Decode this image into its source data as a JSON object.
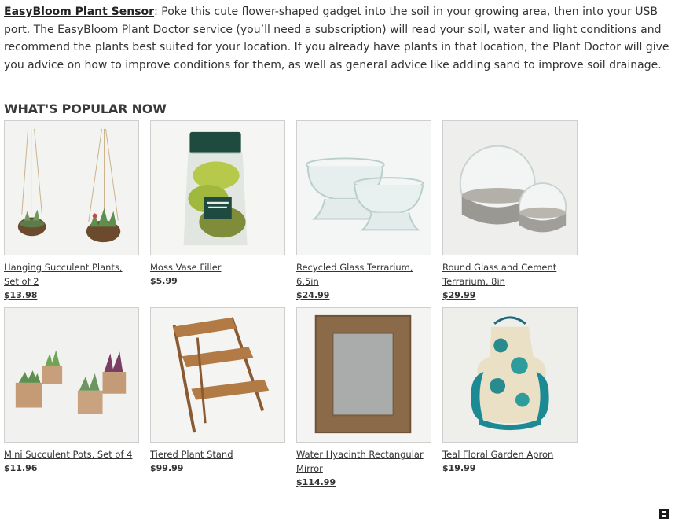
{
  "intro": {
    "link_text": "EasyBloom Plant Sensor",
    "body": ": Poke this cute flower-shaped gadget into the soil in your growing area, then into your USB port. The EasyBloom Plant Doctor service (you’ll need a subscription) will read your soil, water and light conditions and recommend the plants best suited for your location. If you already have plants in that location, the Plant Doctor will give you advice on how to improve conditions for them, as well as general advice like adding sand to improve soil drainage."
  },
  "section_title": "WHAT'S POPULAR NOW",
  "products": [
    {
      "name": "Hanging Succulent Plants, Set of 2",
      "price": "$13.98",
      "image": "hanging-succulents-image"
    },
    {
      "name": "Moss Vase Filler",
      "price": "$5.99",
      "image": "moss-bag-image"
    },
    {
      "name": "Recycled Glass Terrarium, 6.5in",
      "price": "$24.99",
      "image": "glass-terrarium-image"
    },
    {
      "name": "Round Glass and Cement Terrarium, 8in",
      "price": "$29.99",
      "image": "cement-terrarium-image"
    },
    {
      "name": "Mini Succulent Pots, Set of 4",
      "price": "$11.96",
      "image": "succulent-pots-image"
    },
    {
      "name": "Tiered Plant Stand",
      "price": "$99.99",
      "image": "plant-stand-image"
    },
    {
      "name": "Water Hyacinth Rectangular Mirror",
      "price": "$114.99",
      "image": "hyacinth-mirror-image"
    },
    {
      "name": "Teal Floral Garden Apron",
      "price": "$19.99",
      "image": "garden-apron-image"
    }
  ],
  "icons": {
    "corner": "widget-toggle-icon"
  }
}
